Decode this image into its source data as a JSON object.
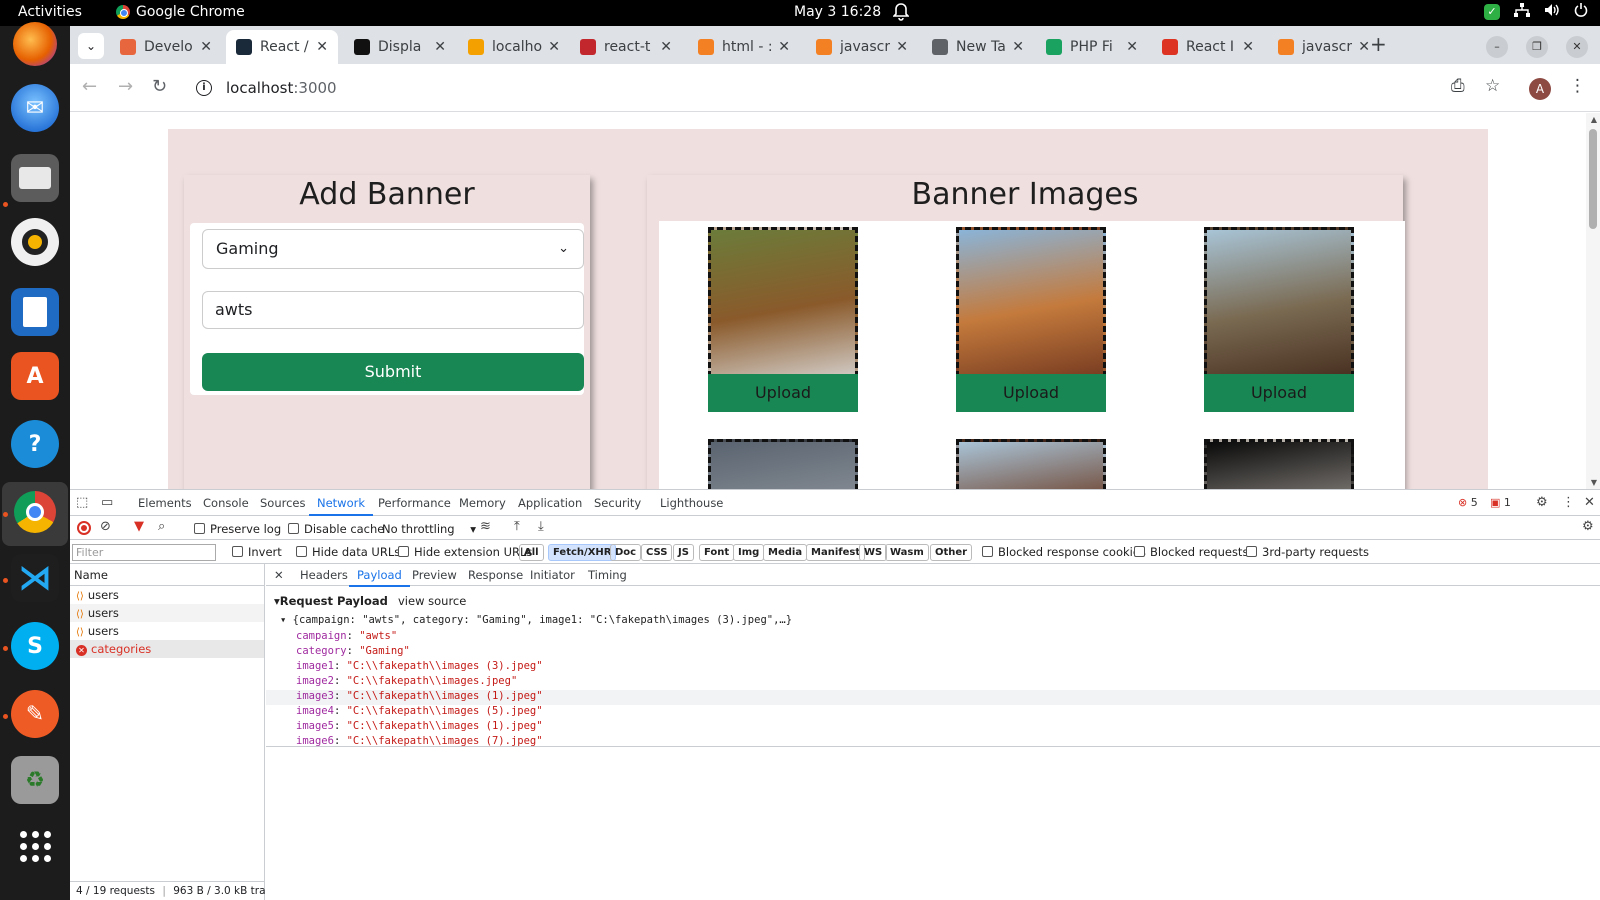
{
  "topbar": {
    "activities": "Activities",
    "app_name": "Google Chrome",
    "clock": "May 3  16:28"
  },
  "dock": {
    "icons": [
      "firefox-icon",
      "thunderbird-icon",
      "files-icon",
      "rhythmbox-icon",
      "writer-icon",
      "app-center-icon",
      "help-icon",
      "chrome-icon",
      "vscode-icon",
      "skype-icon",
      "postman-icon",
      "trash-icon",
      "show-apps-icon"
    ]
  },
  "browser": {
    "tabs": [
      {
        "title": "Develo",
        "color": "#e8663d"
      },
      {
        "title": "React /",
        "color": "#1b2a3a",
        "active": true
      },
      {
        "title": "Displa",
        "color": "#111111"
      },
      {
        "title": "localho",
        "color": "#f4a100"
      },
      {
        "title": "react-t",
        "color": "#c1272d"
      },
      {
        "title": "html - :",
        "color": "#f48024"
      },
      {
        "title": "javascr",
        "color": "#f48024"
      },
      {
        "title": "New Ta",
        "color": "#5f6368"
      },
      {
        "title": "PHP Fi",
        "color": "#1aa260"
      },
      {
        "title": "React I",
        "color": "#dd3322"
      },
      {
        "title": "javascr",
        "color": "#f48024"
      }
    ],
    "url_host": "localhost",
    "url_port": ":3000",
    "avatar_letter": "A"
  },
  "page": {
    "add_banner": {
      "title": "Add Banner",
      "category_value": "Gaming",
      "campaign_value": "awts",
      "submit_label": "Submit"
    },
    "banner_images": {
      "title": "Banner Images",
      "upload_label": "Upload",
      "images": [
        {
          "name": "turtle-image",
          "colors": [
            "#6b7c3a",
            "#8a5a2b",
            "#cfc7c0"
          ]
        },
        {
          "name": "rumi-darwaza-image",
          "colors": [
            "#8ab4d8",
            "#c47a3c",
            "#7a3e22"
          ]
        },
        {
          "name": "bara-imambara-image",
          "colors": [
            "#a8c4d6",
            "#7a6a52",
            "#4a3222"
          ]
        },
        {
          "name": "armor-image",
          "colors": [
            "#5a6470",
            "#8a9098",
            "#2a2e34"
          ]
        },
        {
          "name": "arch-image",
          "colors": [
            "#a9c3d6",
            "#6a3a22",
            "#3a2016"
          ]
        },
        {
          "name": "moon-image",
          "colors": [
            "#0a0a0a",
            "#8a8580",
            "#c0bab2"
          ]
        }
      ]
    }
  },
  "devtools": {
    "tabs": [
      "Elements",
      "Console",
      "Sources",
      "Network",
      "Performance",
      "Memory",
      "Application",
      "Security",
      "Lighthouse"
    ],
    "active_tab": "Network",
    "errors": "5",
    "warnings": "1",
    "preserve_log": "Preserve log",
    "disable_cache": "Disable cache",
    "throttling": "No throttling",
    "filter_placeholder": "Filter",
    "invert": "Invert",
    "hide_data_urls": "Hide data URLs",
    "hide_extension_urls": "Hide extension URLs",
    "type_filters": [
      "All",
      "Fetch/XHR",
      "Doc",
      "CSS",
      "JS",
      "Font",
      "Img",
      "Media",
      "Manifest",
      "WS",
      "Wasm",
      "Other"
    ],
    "active_type_filter": "Fetch/XHR",
    "blocked_cookies": "Blocked response cookies",
    "blocked_requests": "Blocked requests",
    "third_party": "3rd-party requests",
    "name_header": "Name",
    "requests": [
      {
        "name": "users",
        "error": false
      },
      {
        "name": "users",
        "error": false
      },
      {
        "name": "users",
        "error": false
      },
      {
        "name": "categories",
        "error": true
      }
    ],
    "status_requests": "4 / 19 requests",
    "status_transfer": "963 B / 3.0 kB transf",
    "detail_tabs": [
      "Headers",
      "Payload",
      "Preview",
      "Response",
      "Initiator",
      "Timing"
    ],
    "active_detail_tab": "Payload",
    "payload_title": "Request Payload",
    "view_source": "view source",
    "payload_summary": "{campaign: \"awts\", category: \"Gaming\", image1: \"C:\\fakepath\\images (3).jpeg\",…}",
    "payload": [
      {
        "key": "campaign",
        "value": "\"awts\""
      },
      {
        "key": "category",
        "value": "\"Gaming\""
      },
      {
        "key": "image1",
        "value": "\"C:\\\\fakepath\\\\images (3).jpeg\""
      },
      {
        "key": "image2",
        "value": "\"C:\\\\fakepath\\\\images.jpeg\""
      },
      {
        "key": "image3",
        "value": "\"C:\\\\fakepath\\\\images (1).jpeg\""
      },
      {
        "key": "image4",
        "value": "\"C:\\\\fakepath\\\\images (5).jpeg\""
      },
      {
        "key": "image5",
        "value": "\"C:\\\\fakepath\\\\images (1).jpeg\""
      },
      {
        "key": "image6",
        "value": "\"C:\\\\fakepath\\\\images (7).jpeg\""
      }
    ]
  }
}
